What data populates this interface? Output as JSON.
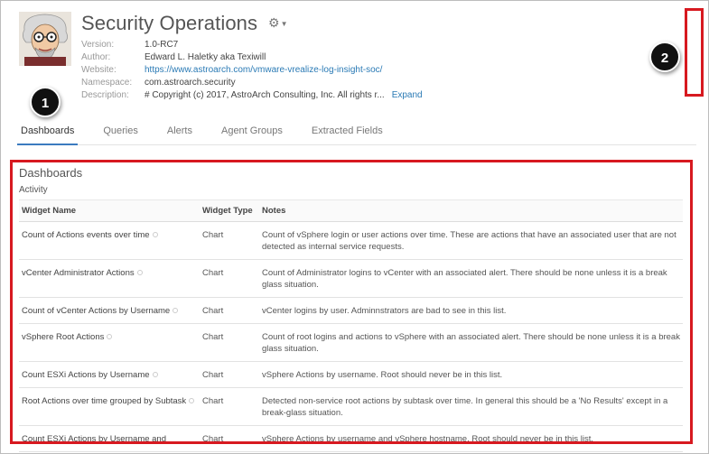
{
  "header": {
    "title": "Security Operations",
    "meta": [
      {
        "key": "Version:",
        "value": "1.0-RC7"
      },
      {
        "key": "Author:",
        "value": "Edward L. Haletky aka Texiwill"
      },
      {
        "key": "Website:",
        "value": "https://www.astroarch.com/vmware-vrealize-log-insight-soc/"
      },
      {
        "key": "Namespace:",
        "value": "com.astroarch.security"
      },
      {
        "key": "Description:",
        "value": "# Copyright (c) 2017, AstroArch Consulting, Inc. All rights r..."
      }
    ],
    "expand_label": "Expand"
  },
  "badges": {
    "one": "1",
    "two": "2"
  },
  "tabs": [
    {
      "label": "Dashboards",
      "active": true
    },
    {
      "label": "Queries"
    },
    {
      "label": "Alerts"
    },
    {
      "label": "Agent Groups"
    },
    {
      "label": "Extracted Fields"
    }
  ],
  "panel": {
    "title": "Dashboards",
    "section": "Activity",
    "columns": [
      "Widget Name",
      "Widget Type",
      "Notes"
    ],
    "rows": [
      {
        "name": "Count of Actions events over time",
        "type": "Chart",
        "notes": "Count of vSphere login or user actions over time. These are actions that have an associated user that are not detected as internal service requests."
      },
      {
        "name": "vCenter Administrator Actions",
        "type": "Chart",
        "notes": "Count of Administrator logins to vCenter with an associated alert. There should be none unless it is a break glass situation."
      },
      {
        "name": "Count of vCenter Actions by Username",
        "type": "Chart",
        "notes": "vCenter logins by user. Adminnstrators are bad to see in this list."
      },
      {
        "name": "vSphere Root Actions",
        "type": "Chart",
        "notes": "Count of root logins and actions to vSphere with an associated alert. There should be none unless it is a break glass situation."
      },
      {
        "name": "Count ESXi Actions by Username",
        "type": "Chart",
        "notes": "vSphere Actions by username. Root should never be in this list."
      },
      {
        "name": "Root Actions over time grouped by Subtask",
        "type": "Chart",
        "notes": "Detected non-service root actions by subtask over time. In general this should be a 'No Results' except in a break-glass situation."
      },
      {
        "name": "Count ESXi Actions by Username and",
        "type": "Chart",
        "notes": "vSphere Actions by username and vSphere hostname. Root should never be in this list."
      }
    ]
  },
  "colors": {
    "highlight": "#d71920",
    "link": "#2a7ab5",
    "tab_active": "#3b7bbf"
  }
}
